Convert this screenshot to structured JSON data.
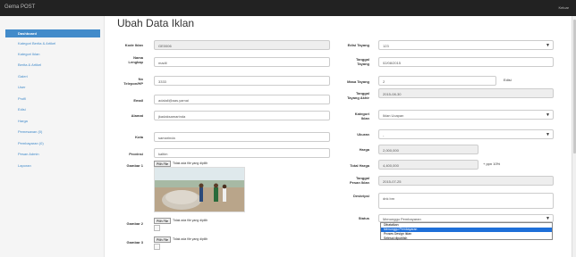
{
  "navbar": {
    "brand": "Gema POST",
    "logout": "Keluar"
  },
  "sidebar": {
    "items": [
      {
        "label": "Dashboard",
        "active": true
      },
      {
        "label": "Kategori Berita & Artikel"
      },
      {
        "label": "Kategori Iklan"
      },
      {
        "label": "Berita & Artikel"
      },
      {
        "label": "Galeri"
      },
      {
        "label": "User"
      },
      {
        "label": "Profil"
      },
      {
        "label": "Edisi"
      },
      {
        "label": "Harga"
      },
      {
        "label": "Pemesanan (0)"
      },
      {
        "label": "Pembayaran (0)"
      },
      {
        "label": "Pesan Admin"
      },
      {
        "label": "Laporan"
      }
    ]
  },
  "page_title": "Ubah Data Iklan",
  "left_form": {
    "kode_label": "Kode Iklan",
    "kode_value": "GE0006",
    "nama_label1": "Nama",
    "nama_label2": "Lengkap",
    "nama_value": "madil",
    "telp_label1": "No",
    "telp_label2": "Telepon/HP",
    "telp_value": "3333",
    "email_label": "Email",
    "email_value": "adalali@aas.yamai",
    "alamat_label": "Alamat",
    "alamat_value": "jkadaksamarinda",
    "kota_label": "Kota",
    "kota_value": "samarinda",
    "provinsi_label": "Provinsi",
    "provinsi_value": "kaltim",
    "gambar1_label": "Gambar 1",
    "gambar2_label": "Gambar 2",
    "gambar3_label": "Gambar 3",
    "file_button": "Pilih File",
    "file_none": "Tidak ada file yang dipilih"
  },
  "right_form": {
    "edisi_label": "Edisi Tayang",
    "edisi_value": "123",
    "tgl_label1": "Tanggal",
    "tgl_label2": "Tayang",
    "tgl_value": "02/08/2015",
    "masa_label": "Masa Tayang",
    "masa_value": "2",
    "masa_unit": "Edisi",
    "akhir_label1": "Tanggal",
    "akhir_label2": "Tayang Akhir",
    "akhir_value": "2015-08-30",
    "kategori_label1": "Kategori",
    "kategori_label2": "Iklan",
    "kategori_value": "Iklan Ucapan",
    "ukuran_label": "Ukuran",
    "ukuran_value": "-",
    "harga_label": "Harga",
    "harga_value": "2,000,000",
    "total_label": "Total Harga",
    "total_value": "4,400,000",
    "ppn_note": "+ ppn 10%",
    "pesan_label1": "Tanggal",
    "pesan_label2": "Pesan Iklan",
    "pesan_value": "2015-07-25",
    "deskripsi_label": "Deskripsi",
    "deskripsi_value": "dnk bm",
    "status_label": "Status",
    "status_value": "Menunggu Pembayaran",
    "status_options": [
      "Dibatalkan",
      "Menunggu Pembayaran",
      "Proses Design Iklan",
      "Selesai dipublish"
    ],
    "status_selected_index": 1
  }
}
